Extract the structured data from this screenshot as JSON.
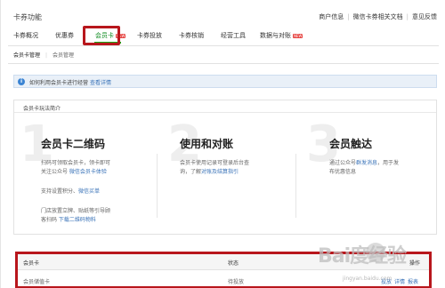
{
  "header": {
    "title": "卡券功能",
    "links": [
      "商户信息",
      "微信卡券相关文档",
      "意见反馈"
    ]
  },
  "tabs": [
    {
      "label": "卡券概况",
      "active": false
    },
    {
      "label": "优惠券",
      "active": false
    },
    {
      "label": "会员卡",
      "active": true,
      "badge": "NEW"
    },
    {
      "label": "卡券投放",
      "active": false
    },
    {
      "label": "卡券核销",
      "active": false
    },
    {
      "label": "经营工具",
      "active": false
    },
    {
      "label": "数据与对账",
      "active": false,
      "badge": "NEW"
    }
  ],
  "subtabs": [
    {
      "label": "会员卡管理",
      "active": true
    },
    {
      "label": "会员管理",
      "active": false
    }
  ],
  "info": {
    "icon": "info-icon",
    "text": "如何利用会员卡进行经营",
    "link": "查看详情"
  },
  "intro": {
    "title": "会员卡玩法简介",
    "features": [
      {
        "number": "1",
        "title": "会员卡二维码",
        "lines": [
          {
            "text": "扫码可领取会员卡，领卡即可",
            "link": ""
          },
          {
            "text": "关注公众号 ",
            "link": "微信会员卡体验"
          },
          {
            "text": "支持设置积分、",
            "link": "微信买单"
          },
          {
            "text": "门店放置立牌、贴纸等引导顾",
            "link": ""
          },
          {
            "text": "客扫码 ",
            "link": "下载二维码物料"
          }
        ]
      },
      {
        "number": "2",
        "title": "使用和对账",
        "lines": [
          {
            "text": "会员卡使用记录可登录后台查",
            "link": ""
          },
          {
            "text": "询，了解",
            "link": "对账及结算指引"
          }
        ]
      },
      {
        "number": "3",
        "title": "会员触达",
        "lines": [
          {
            "text": "通过公众号",
            "link": "群发消息",
            "suffix": "，用于发"
          },
          {
            "text": "布优惠信息",
            "link": ""
          }
        ]
      }
    ]
  },
  "table": {
    "headers": [
      "会员卡",
      "状态",
      "操作"
    ],
    "rows": [
      {
        "name": "会员储值卡",
        "status": "待投放",
        "ops": [
          "投放",
          "详情",
          "报表"
        ]
      }
    ]
  },
  "watermark": {
    "logo": "Bai度经验",
    "sub": "jingyan.baidu.com"
  },
  "colors": {
    "accent": "#1aad19",
    "highlight_box": "#b8161c",
    "link": "#3a73b8",
    "badge": "#e64340"
  }
}
